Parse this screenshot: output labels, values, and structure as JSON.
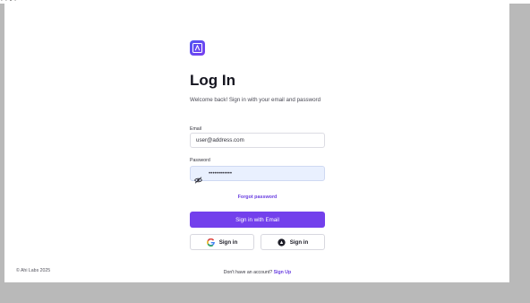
{
  "top_fragment": "- - •  -",
  "login": {
    "title": "Log In",
    "subtitle": "Welcome back! Sign in with your email and password",
    "email_label": "Email",
    "email_value": "user@address.com",
    "password_label": "Password",
    "password_value": "••••••••••••",
    "forgot_label": "Forgot password",
    "primary_button": "Sign in with Email",
    "google_button": "Sign in",
    "second_button": "Sign in"
  },
  "footer": {
    "copyright": "© Ahi Labs 2025",
    "signup_prompt": "Don't have an account?",
    "signup_link": "Sign Up"
  },
  "icons": {
    "logo": "caret-logo-icon",
    "password_toggle": "eye-off-icon",
    "google": "google-icon",
    "second": "app-logo-icon"
  },
  "colors": {
    "accent": "#7340ec",
    "link": "#6a3fe0",
    "password_fill": "#e9f0fe",
    "backdrop": "#b9b9b9",
    "card": "#ffffff"
  }
}
